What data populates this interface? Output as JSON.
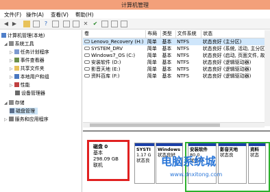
{
  "window": {
    "title": "计算机管理"
  },
  "menu": [
    "文件(F)",
    "操作(A)",
    "查看(V)",
    "帮助(H)"
  ],
  "tree": {
    "root": "计算机管理(本地)",
    "system_tools": "系统工具",
    "task_scheduler": "任务计划程序",
    "event_viewer": "事件查看器",
    "shared_folders": "共享文件夹",
    "local_users": "本地用户和组",
    "performance": "性能",
    "device_manager": "设备管理器",
    "storage": "存储",
    "disk_management": "磁盘管理",
    "services_apps": "服务和应用程序"
  },
  "volumes": {
    "columns": [
      "卷",
      "布局",
      "类型",
      "文件系统",
      "状态"
    ],
    "rows": [
      [
        "Lenovo_Recovery (H:)",
        "简单",
        "基本",
        "NTFS",
        "状态良好 (主分区)"
      ],
      [
        "SYSTEM_DRV",
        "简单",
        "基本",
        "NTFS",
        "状态良好 (系统, 活动, 主分区)"
      ],
      [
        "Windows7_OS (C:)",
        "简单",
        "基本",
        "NTFS",
        "状态良好 (启动, 页面文件, 故障"
      ],
      [
        "安装软件 (D:)",
        "简单",
        "基本",
        "NTFS",
        "状态良好 (逻辑驱动器)"
      ],
      [
        "影音天地 (E:)",
        "简单",
        "基本",
        "NTFS",
        "状态良好 (逻辑驱动器)"
      ],
      [
        "资料百库 (F:)",
        "简单",
        "基本",
        "NTFS",
        "状态良好 (逻辑驱动器)"
      ]
    ]
  },
  "disk": {
    "name": "磁盘 0",
    "type": "基本",
    "size": "298.09 GB",
    "status": "联机"
  },
  "partitions": [
    {
      "name": "SYSTI",
      "size": "1.17 G",
      "status": "状态良"
    },
    {
      "name": "Windows",
      "size": "",
      "status": "状态良好"
    },
    {
      "name": "安装软件",
      "size": "80.0",
      "status": "状态良"
    },
    {
      "name": "影音天地",
      "size": "",
      "status": "状态良"
    },
    {
      "name": "资料",
      "size": "",
      "status": "状态"
    }
  ],
  "watermark": {
    "text": "电脑系统城",
    "url": "www.dnxitong.com"
  }
}
